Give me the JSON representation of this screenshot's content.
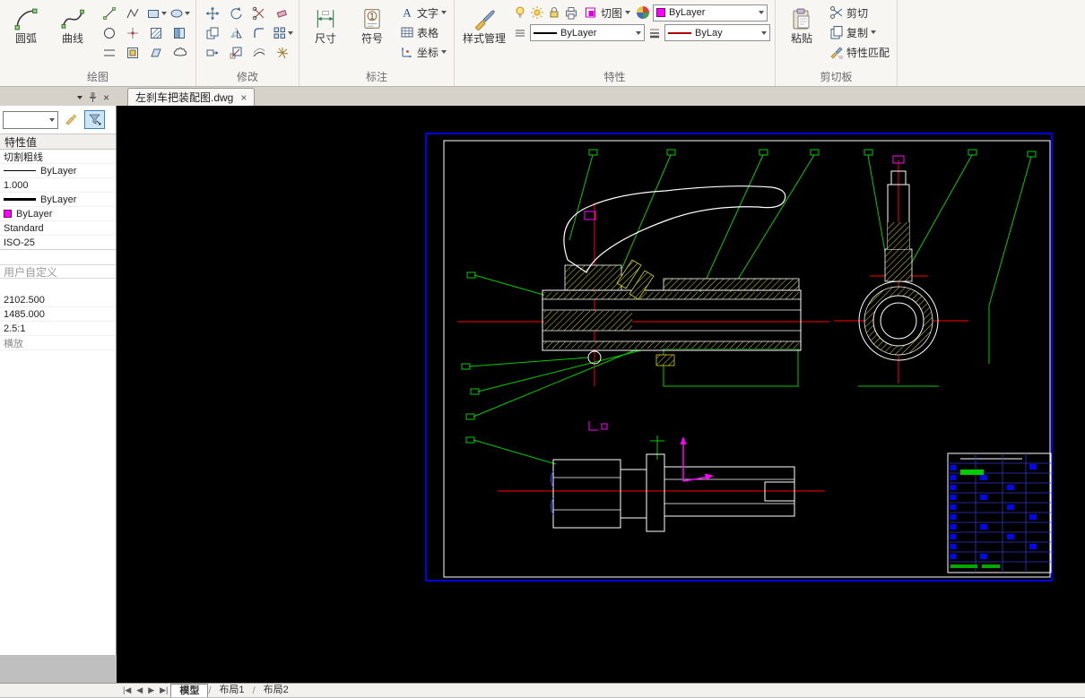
{
  "colors": {
    "frame_blue": "#0000ee",
    "cad_green": "#00cc00",
    "cad_red": "#ff0000",
    "cad_yellow": "#e8e800",
    "cad_magenta": "#ff00ff",
    "selection_blue": "#3c7fb1"
  },
  "ribbon": {
    "draw": {
      "label": "绘图",
      "arc": "圆弧",
      "spline": "曲线"
    },
    "modify": {
      "label": "修改"
    },
    "annotate": {
      "label": "标注",
      "dimension": "尺寸",
      "symbol": "符号",
      "text": "文字",
      "table": "表格",
      "coordinate": "坐标"
    },
    "properties": {
      "label": "特性",
      "style_manager": "样式管理",
      "clip": "切图",
      "color_value": "ByLayer",
      "linetype_value": "ByLayer",
      "lineweight_value": "ByLay"
    },
    "clipboard": {
      "label": "剪切板",
      "paste": "粘贴",
      "cut": "剪切",
      "copy": "复制",
      "match": "特性匹配"
    }
  },
  "tabbar": {
    "document": "左刹车把装配图.dwg",
    "close": "×"
  },
  "palette": {
    "header": "特性值",
    "rows": [
      {
        "label": "切割粗线"
      },
      {
        "label": "ByLayer"
      },
      {
        "label": "1.000"
      },
      {
        "label": "ByLayer"
      },
      {
        "label": "ByLayer"
      },
      {
        "label": "Standard"
      },
      {
        "label": "ISO-25"
      }
    ],
    "section_user": "用户自定义",
    "user_rows": [
      {
        "label": "2102.500"
      },
      {
        "label": "1485.000"
      },
      {
        "label": "2.5:1"
      },
      {
        "label": "横放"
      }
    ]
  },
  "statusbar": {
    "nav_first": "|◀",
    "nav_prev": "◀",
    "nav_next": "▶",
    "nav_last": "▶|",
    "tabs": [
      {
        "label": "模型"
      },
      {
        "label": "布局1"
      },
      {
        "label": "布局2"
      }
    ]
  }
}
